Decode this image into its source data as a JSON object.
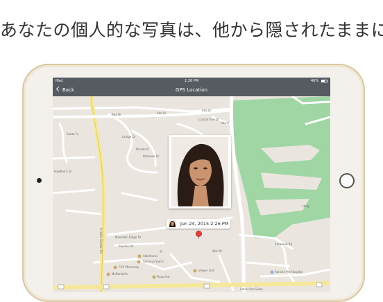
{
  "headline": "あなたの個人的な写真は、他から隠されたままに",
  "status": {
    "device": "iPad",
    "time": "2:26 PM",
    "battery": "46%"
  },
  "nav": {
    "back_label": "Back",
    "title": "GPS Location"
  },
  "callout": {
    "timestamp": "Jun 24, 2015 2:26 PM"
  },
  "colors": {
    "navbar": "#555b60",
    "map_bg": "#eae6df",
    "park": "#9fd6a4",
    "road_main": "#f6e89a",
    "pin": "#e0413c",
    "device_frame": "#d9c7a3"
  },
  "map_labels": {
    "alta_dr_1": "Alta Dr",
    "alta_dr_2": "Alta Dr",
    "alta_dr_3": "Alta Dr",
    "crystal_tree": "Crystal Tree Dr",
    "harris": "Harris",
    "santa_fe": "Santa Fe",
    "mirada": "Mirada Pl",
    "parkview": "Parkview Dr",
    "lehigh": "Lehigh Dr",
    "hawthorn": "Hawthorn Dr",
    "mountain_ridge": "Mountain Ridge Dr",
    "rancho": "Rancho Rd",
    "ironwood": "Ironwood Rd",
    "star_dr": "Star Dr",
    "albertsons": "Albertsons",
    "samurai": "Samurai Sam's",
    "cvs": "CVS Pharmacy",
    "mcdonalds": "McDonald's",
    "pizza_hut": "Pizza Hut",
    "viewer_grill": "Viewer Grill",
    "rancho_pet": "Rancho Pet Hospital",
    "smile_one": "Smile One Salon",
    "s_hollis": "S Hollis Garden Rd",
    "holly": "Holly"
  }
}
